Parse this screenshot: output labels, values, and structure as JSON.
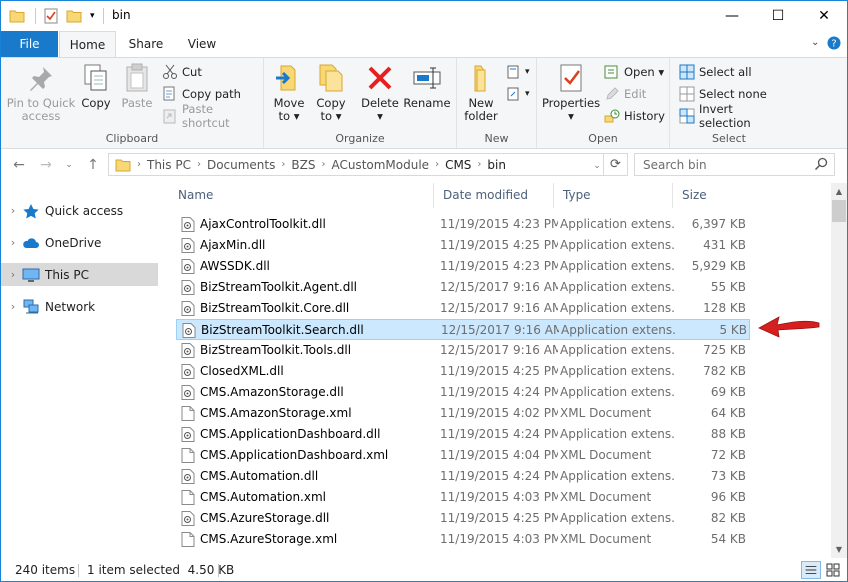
{
  "window": {
    "title": "bin",
    "minimize": "—",
    "maximize": "☐",
    "close": "✕"
  },
  "ribbon_tabs": {
    "file": "File",
    "home": "Home",
    "share": "Share",
    "view": "View"
  },
  "ribbon": {
    "clipboard": {
      "label": "Clipboard",
      "pin": "Pin to Quick\naccess",
      "copy": "Copy",
      "paste": "Paste",
      "cut": "Cut",
      "copy_path": "Copy path",
      "paste_shortcut": "Paste shortcut"
    },
    "organize": {
      "label": "Organize",
      "move_to": "Move\nto ▾",
      "copy_to": "Copy\nto ▾",
      "delete": "Delete\n▾",
      "rename": "Rename"
    },
    "new": {
      "label": "New",
      "new_folder": "New\nfolder"
    },
    "open": {
      "label": "Open",
      "properties": "Properties\n▾",
      "open": "Open ▾",
      "edit": "Edit",
      "history": "History"
    },
    "select": {
      "label": "Select",
      "select_all": "Select all",
      "select_none": "Select none",
      "invert": "Invert selection"
    }
  },
  "address": {
    "crumbs": [
      "This PC",
      "Documents",
      "BZS",
      "ACustomModule",
      "CMS",
      "bin"
    ],
    "search_placeholder": "Search bin"
  },
  "sidebar": {
    "items": [
      {
        "label": "Quick access",
        "icon": "star-icon"
      },
      {
        "label": "OneDrive",
        "icon": "cloud-icon"
      },
      {
        "label": "This PC",
        "icon": "computer-icon"
      },
      {
        "label": "Network",
        "icon": "network-icon"
      }
    ]
  },
  "columns": {
    "name": "Name",
    "date": "Date modified",
    "type": "Type",
    "size": "Size"
  },
  "files": [
    {
      "name": "AjaxControlToolkit.dll",
      "date": "11/19/2015 4:23 PM",
      "type": "Application extens...",
      "size": "6,397 KB",
      "kind": "dll"
    },
    {
      "name": "AjaxMin.dll",
      "date": "11/19/2015 4:25 PM",
      "type": "Application extens...",
      "size": "431 KB",
      "kind": "dll"
    },
    {
      "name": "AWSSDK.dll",
      "date": "11/19/2015 4:23 PM",
      "type": "Application extens...",
      "size": "5,929 KB",
      "kind": "dll"
    },
    {
      "name": "BizStreamToolkit.Agent.dll",
      "date": "12/15/2017 9:16 AM",
      "type": "Application extens...",
      "size": "55 KB",
      "kind": "dll"
    },
    {
      "name": "BizStreamToolkit.Core.dll",
      "date": "12/15/2017 9:16 AM",
      "type": "Application extens...",
      "size": "128 KB",
      "kind": "dll"
    },
    {
      "name": "BizStreamToolkit.Search.dll",
      "date": "12/15/2017 9:16 AM",
      "type": "Application extens...",
      "size": "5 KB",
      "kind": "dll",
      "selected": true
    },
    {
      "name": "BizStreamToolkit.Tools.dll",
      "date": "12/15/2017 9:16 AM",
      "type": "Application extens...",
      "size": "725 KB",
      "kind": "dll"
    },
    {
      "name": "ClosedXML.dll",
      "date": "11/19/2015 4:25 PM",
      "type": "Application extens...",
      "size": "782 KB",
      "kind": "dll"
    },
    {
      "name": "CMS.AmazonStorage.dll",
      "date": "11/19/2015 4:24 PM",
      "type": "Application extens...",
      "size": "69 KB",
      "kind": "dll"
    },
    {
      "name": "CMS.AmazonStorage.xml",
      "date": "11/19/2015 4:02 PM",
      "type": "XML Document",
      "size": "64 KB",
      "kind": "xml"
    },
    {
      "name": "CMS.ApplicationDashboard.dll",
      "date": "11/19/2015 4:24 PM",
      "type": "Application extens...",
      "size": "88 KB",
      "kind": "dll"
    },
    {
      "name": "CMS.ApplicationDashboard.xml",
      "date": "11/19/2015 4:04 PM",
      "type": "XML Document",
      "size": "72 KB",
      "kind": "xml"
    },
    {
      "name": "CMS.Automation.dll",
      "date": "11/19/2015 4:24 PM",
      "type": "Application extens...",
      "size": "73 KB",
      "kind": "dll"
    },
    {
      "name": "CMS.Automation.xml",
      "date": "11/19/2015 4:03 PM",
      "type": "XML Document",
      "size": "96 KB",
      "kind": "xml"
    },
    {
      "name": "CMS.AzureStorage.dll",
      "date": "11/19/2015 4:25 PM",
      "type": "Application extens...",
      "size": "82 KB",
      "kind": "dll"
    },
    {
      "name": "CMS.AzureStorage.xml",
      "date": "11/19/2015 4:03 PM",
      "type": "XML Document",
      "size": "54 KB",
      "kind": "xml"
    }
  ],
  "status": {
    "count": "240 items",
    "selection": "1 item selected  4.50 KB"
  },
  "colors": {
    "accent": "#1979ca",
    "selection": "#cce8ff",
    "arrow": "#d61f1f"
  }
}
